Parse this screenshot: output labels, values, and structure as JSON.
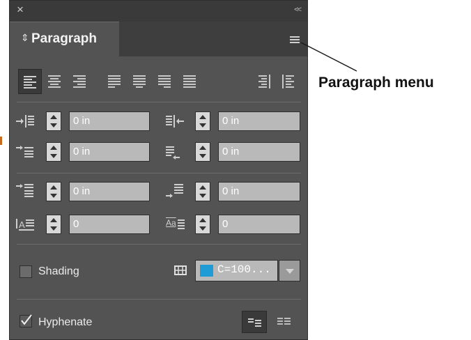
{
  "window": {
    "close_glyph": "×",
    "collapse_glyph": "<<"
  },
  "tab": {
    "label": "Paragraph",
    "chevron": "⇕"
  },
  "alignment_buttons": [
    {
      "name": "align-left",
      "active": true
    },
    {
      "name": "align-center",
      "active": false
    },
    {
      "name": "align-right",
      "active": false
    },
    {
      "name": "justify-left",
      "active": false
    },
    {
      "name": "justify-center",
      "active": false
    },
    {
      "name": "justify-right",
      "active": false
    },
    {
      "name": "justify-all",
      "active": false
    },
    {
      "name": "align-towards-spine",
      "active": false
    },
    {
      "name": "align-away-from-spine",
      "active": false
    }
  ],
  "indents": {
    "left_indent": "0 in",
    "right_indent": "0 in",
    "first_line_indent": "0 in",
    "last_line_indent": "0 in"
  },
  "spacing": {
    "space_before": "0 in",
    "space_after": "0 in",
    "drop_cap_lines": "0",
    "drop_cap_chars": "0"
  },
  "drop_cap_icon_label": "Aa",
  "shading": {
    "label": "Shading",
    "checked": false,
    "swatch_label": "C=100...",
    "swatch_color": "#1f9bd6"
  },
  "hyphenate": {
    "label": "Hyphenate",
    "checked": true
  },
  "callout": {
    "label": "Paragraph menu"
  }
}
